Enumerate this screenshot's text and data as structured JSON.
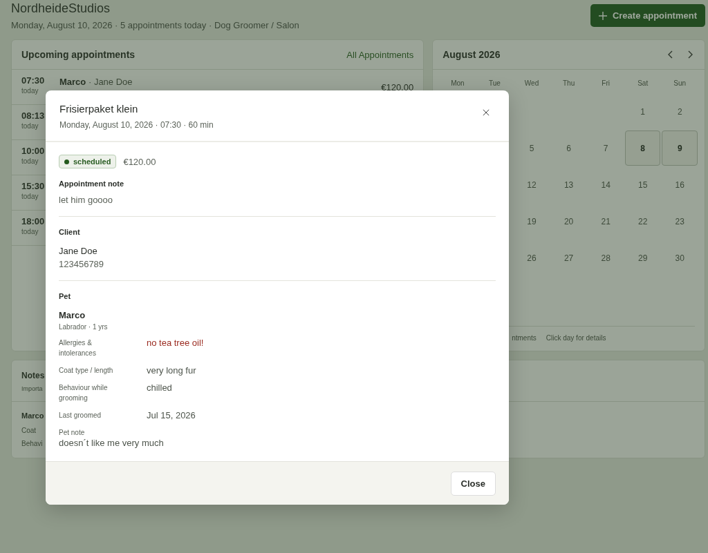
{
  "header": {
    "title": "NordheideStudios",
    "subtitle": "Monday, August 10, 2026 · 5 appointments today · Dog Groomer / Salon",
    "create_button": "Create appointment"
  },
  "upcoming": {
    "title": "Upcoming appointments",
    "link": "All Appointments",
    "rows": [
      {
        "time": "07:30",
        "day": "today",
        "pet": "Marco",
        "separator": "·",
        "client": "Jane Doe",
        "price": "€120.00"
      },
      {
        "time": "08:13",
        "day": "today"
      },
      {
        "time": "10:00",
        "day": "today"
      },
      {
        "time": "15:30",
        "day": "today"
      },
      {
        "time": "18:00",
        "day": "today"
      }
    ]
  },
  "calendar": {
    "title": "August 2026",
    "weekdays": [
      "Mon",
      "Tue",
      "Wed",
      "Thu",
      "Fri",
      "Sat",
      "Sun"
    ],
    "weeks": [
      [
        {
          "day": "1",
          "marked": false
        },
        {
          "day": "2",
          "marked": false
        }
      ],
      [
        {
          "day": "5",
          "marked": false
        },
        {
          "day": "6",
          "marked": false
        },
        {
          "day": "7",
          "marked": false
        },
        {
          "day": "8",
          "marked": true
        },
        {
          "day": "9",
          "marked": true
        }
      ],
      [
        {
          "day": "12",
          "marked": false
        },
        {
          "day": "13",
          "marked": false
        },
        {
          "day": "14",
          "marked": false
        },
        {
          "day": "15",
          "marked": false
        },
        {
          "day": "16",
          "marked": false
        }
      ],
      [
        {
          "day": "19",
          "marked": false
        },
        {
          "day": "20",
          "marked": false
        },
        {
          "day": "21",
          "marked": false
        },
        {
          "day": "22",
          "marked": false
        },
        {
          "day": "23",
          "marked": false
        }
      ],
      [
        {
          "day": "26",
          "marked": false
        },
        {
          "day": "27",
          "marked": false
        },
        {
          "day": "28",
          "marked": false
        },
        {
          "day": "29",
          "marked": false
        },
        {
          "day": "30",
          "marked": false
        }
      ]
    ],
    "legend": [
      "ntments",
      "Click day for details"
    ]
  },
  "notes": {
    "title": "Notes",
    "subtitle": "Importa",
    "pet": "Marco",
    "lines": [
      "Coat",
      "Behavi"
    ]
  },
  "modal": {
    "title": "Frisierpaket klein",
    "subtitle": "Monday, August 10, 2026 · 07:30 · 60 min",
    "status": "scheduled",
    "price": "€120.00",
    "appointment_note": {
      "label": "Appointment note",
      "text": "let him goooo"
    },
    "client": {
      "label": "Client",
      "name": "Jane Doe",
      "phone": "123456789"
    },
    "pet": {
      "label": "Pet",
      "name": "Marco",
      "info": "Labrador · 1 yrs",
      "fields": [
        {
          "kind": "alert",
          "label": "Allergies & intolerances",
          "value": "no tea tree oil!"
        },
        {
          "kind": "plain",
          "label": "Coat type / length",
          "value": "very long fur"
        },
        {
          "kind": "plain",
          "label": "Behaviour while grooming",
          "value": "chilled"
        },
        {
          "kind": "plain",
          "label": "Last groomed",
          "value": "Jul 15, 2026"
        },
        {
          "kind": "note",
          "label": "Pet note",
          "value": "doesn´t like me very much"
        }
      ]
    },
    "close_button": "Close"
  }
}
